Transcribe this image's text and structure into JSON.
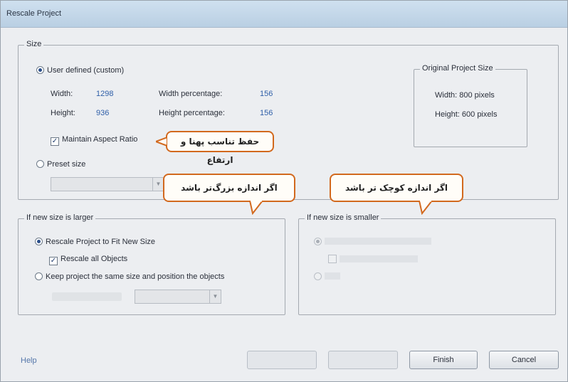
{
  "window": {
    "title": "Rescale Project"
  },
  "size_group": {
    "legend": "Size",
    "user_defined_label": "User defined (custom)",
    "width_label": "Width:",
    "width_value": "1298",
    "height_label": "Height:",
    "height_value": "936",
    "width_pct_label": "Width percentage:",
    "width_pct_value": "156",
    "height_pct_label": "Height percentage:",
    "height_pct_value": "156",
    "maintain_aspect_label": "Maintain Aspect Ratio",
    "preset_label": "Preset size"
  },
  "original_group": {
    "legend": "Original Project Size",
    "width_text": "Width: 800 pixels",
    "height_text": "Height: 600 pixels"
  },
  "larger_group": {
    "legend": "If new size is larger",
    "rescale_fit_label": "Rescale Project to Fit New Size",
    "rescale_all_label": "Rescale all Objects",
    "keep_same_label": "Keep project the same size and position the objects"
  },
  "smaller_group": {
    "legend": "If new size is smaller"
  },
  "annotations": {
    "aspect_note": "حفظ تناسب پهنا و ارتفاع",
    "larger_note": "اگر اندازه بزرگ‌تر باشد",
    "smaller_note": "اگر اندازه کوچک تر باشد"
  },
  "footer": {
    "help_label": "Help",
    "finish_label": "Finish",
    "cancel_label": "Cancel"
  },
  "colors": {
    "annotation_border": "#d2691e",
    "value_text": "#2f5fa8"
  }
}
